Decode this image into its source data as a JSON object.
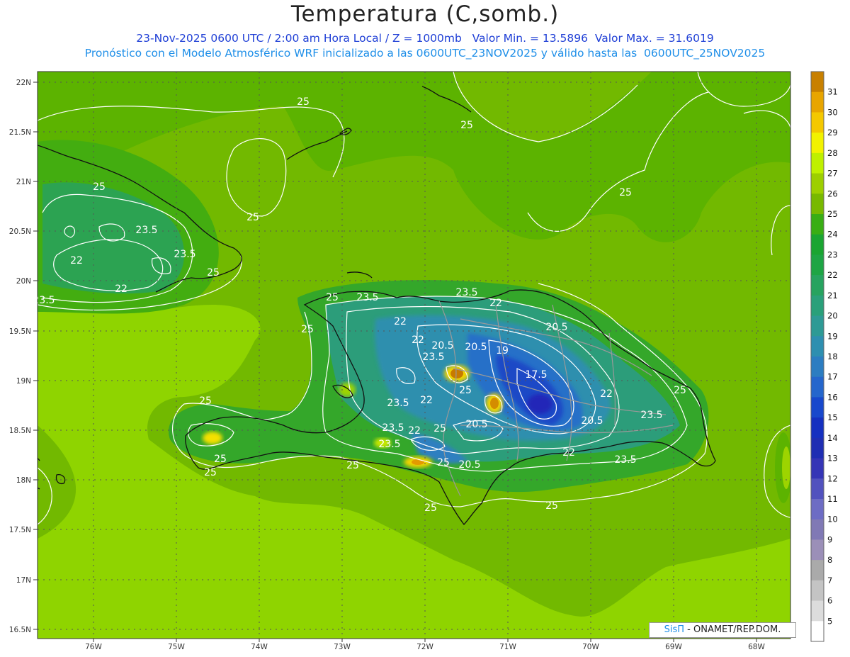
{
  "header": {
    "title": "Temperatura (C,somb.)",
    "line1": "23-Nov-2025 0600 UTC / 2:00 am Hora Local / Z = 1000mb   Valor Min. = 13.5896  Valor Max. = 31.6019",
    "line2": "Pronóstico con el Modelo Atmosférico WRF inicializado a las 0600UTC_23NOV2025 y válido hasta las  0600UTC_25NOV2025"
  },
  "axes": {
    "lat_labels": [
      "22N",
      "21.5N",
      "21N",
      "20.5N",
      "20N",
      "19.5N",
      "19N",
      "18.5N",
      "18N",
      "17.5N",
      "17N",
      "16.5N"
    ],
    "lon_labels": [
      "76W",
      "75W",
      "74W",
      "73W",
      "72W",
      "71W",
      "70W",
      "69W",
      "68W"
    ]
  },
  "colorbar": {
    "levels": [
      "5",
      "6",
      "7",
      "8",
      "9",
      "10",
      "11",
      "12",
      "13",
      "14",
      "15",
      "16",
      "17",
      "18",
      "19",
      "20",
      "21",
      "22",
      "23",
      "24",
      "25",
      "26",
      "27",
      "28",
      "29",
      "30",
      "31"
    ],
    "colors": [
      "#ffffff",
      "#dcdcdc",
      "#c4c4c4",
      "#aaaaaa",
      "#9b8fb8",
      "#8079b5",
      "#6d6cc4",
      "#5252be",
      "#3535b6",
      "#1f2eb3",
      "#1530c0",
      "#1848cc",
      "#2566cc",
      "#2c7dc1",
      "#2e8fb0",
      "#2e9a95",
      "#2aa07a",
      "#27a35f",
      "#1ea544",
      "#1aa531",
      "#39ae14",
      "#78b900",
      "#9dcf00",
      "#bff000",
      "#f2f200",
      "#f4c800",
      "#e8a500",
      "#c88000"
    ]
  },
  "contour_labels": {
    "c25": "25",
    "c235": "23.5",
    "c22": "22",
    "c205": "20.5",
    "c19": "19",
    "c175": "17.5"
  },
  "credit": {
    "sis": "SisΠ",
    "rest": " - ONAMET/REP.DOM."
  }
}
